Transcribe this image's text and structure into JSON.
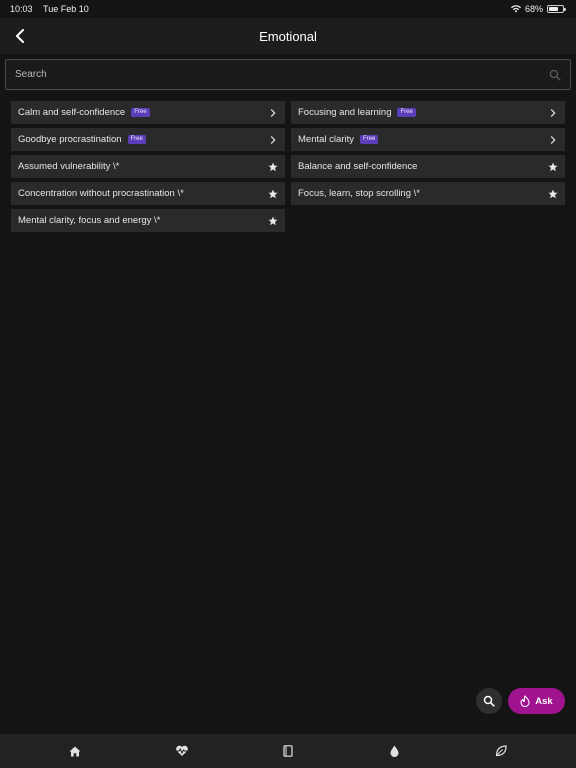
{
  "status": {
    "time": "10:03",
    "date": "Tue Feb 10",
    "battery": "68%",
    "battery_level": 0.68
  },
  "header": {
    "title": "Emotional",
    "back_icon": "chevron-left-icon"
  },
  "search": {
    "placeholder": "Search",
    "value": ""
  },
  "items": [
    {
      "label": "Calm and self-confidence",
      "badge": "Free",
      "trailing_icon": "chevron-right-icon"
    },
    {
      "label": "Focusing and learning",
      "badge": "Free",
      "trailing_icon": "chevron-right-icon"
    },
    {
      "label": "Goodbye procrastination",
      "badge": "Free",
      "trailing_icon": "chevron-right-icon"
    },
    {
      "label": "Mental clarity",
      "badge": "Free",
      "trailing_icon": "chevron-right-icon"
    },
    {
      "label": "Assumed vulnerability \\*",
      "badge": "",
      "trailing_icon": "star-icon"
    },
    {
      "label": "Balance and self-confidence",
      "badge": "",
      "trailing_icon": "star-icon"
    },
    {
      "label": "Concentration without procrastination \\*",
      "badge": "",
      "trailing_icon": "star-icon"
    },
    {
      "label": "Focus, learn, stop scrolling \\*",
      "badge": "",
      "trailing_icon": "star-icon"
    },
    {
      "label": "Mental clarity, focus and energy \\*",
      "badge": "",
      "trailing_icon": "star-icon"
    }
  ],
  "floating": {
    "search_icon": "search-icon",
    "ask_label": "Ask",
    "ask_icon": "flame-icon"
  },
  "tabs": [
    {
      "icon": "home-icon"
    },
    {
      "icon": "heartbeat-icon"
    },
    {
      "icon": "book-icon"
    },
    {
      "icon": "drop-icon"
    },
    {
      "icon": "leaf-icon"
    }
  ],
  "colors": {
    "background": "#141414",
    "card": "#2a2a2d",
    "badge": "#5b3fb8",
    "accent": "#a0138e"
  }
}
